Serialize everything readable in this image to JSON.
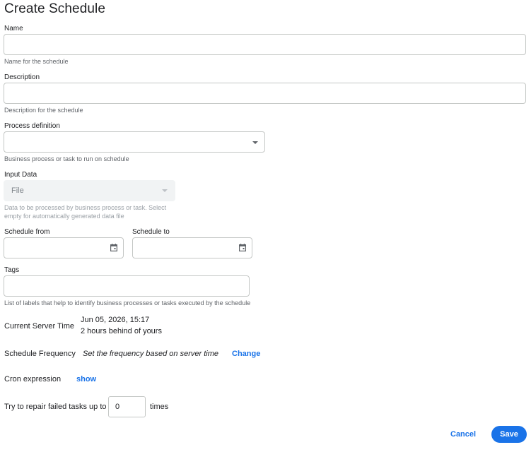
{
  "page": {
    "title": "Create Schedule"
  },
  "form": {
    "name": {
      "label": "Name",
      "value": "",
      "helper": "Name for the schedule"
    },
    "description": {
      "label": "Description",
      "value": "",
      "helper": "Description for the schedule"
    },
    "process_definition": {
      "label": "Process definition",
      "value": "",
      "helper": "Business process or task to run on schedule",
      "icon": "chevron-down-icon"
    },
    "input_data": {
      "label": "Input Data",
      "value": "File",
      "helper_line1": "Data to be processed by business process or task. Select",
      "helper_line2": "empty for automatically generated data file",
      "icon": "chevron-down-icon",
      "disabled": true
    },
    "schedule_from": {
      "label": "Schedule from",
      "value": "",
      "icon": "calendar-icon"
    },
    "schedule_to": {
      "label": "Schedule to",
      "value": "",
      "icon": "calendar-icon"
    },
    "tags": {
      "label": "Tags",
      "value": "",
      "helper": "List of labels that help to identify business processes or tasks executed by the schedule"
    }
  },
  "server_time": {
    "label": "Current Server Time",
    "value": "Jun 05, 2026, 15:17",
    "offset": "2 hours behind of yours"
  },
  "frequency": {
    "label": "Schedule Frequency",
    "value": "Set the frequency based on server time",
    "change_label": "Change"
  },
  "cron": {
    "label": "Cron expression",
    "show_label": "show"
  },
  "repair": {
    "prefix": "Try to repair failed tasks up to",
    "value": "0",
    "suffix": "times"
  },
  "actions": {
    "cancel_label": "Cancel",
    "save_label": "Save"
  },
  "colors": {
    "accent": "#1a73e8",
    "border": "#c4c7c5",
    "disabled_bg": "#f1f3f4"
  }
}
